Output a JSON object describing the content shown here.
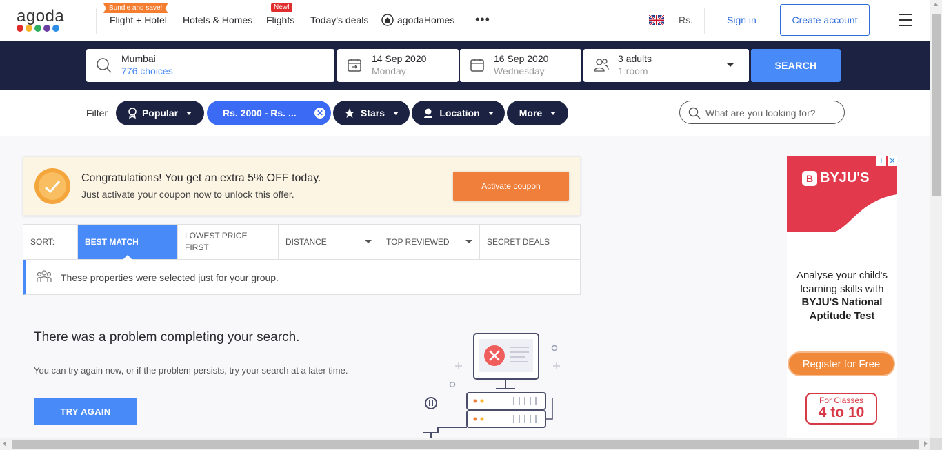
{
  "header": {
    "logo_text": "agoda",
    "logo_colors": [
      "#e12d2d",
      "#f7b32b",
      "#2fad5e",
      "#6b3fa0",
      "#2c8de5"
    ],
    "bundle_badge": "Bundle and save!",
    "nav_flight_hotel": "Flight + Hotel",
    "nav_hotels_homes": "Hotels & Homes",
    "new_badge": "New!",
    "nav_flights": "Flights",
    "nav_deals": "Today's deals",
    "nav_agoda_homes": "agodaHomes",
    "more": "•••",
    "currency": "Rs.",
    "sign_in": "Sign in",
    "create_account": "Create account"
  },
  "search": {
    "destination": "Mumbai",
    "choices": "776 choices",
    "checkin_date": "14 Sep 2020",
    "checkin_day": "Monday",
    "checkout_date": "16 Sep 2020",
    "checkout_day": "Wednesday",
    "guests": "3 adults",
    "rooms": "1 room",
    "button": "SEARCH"
  },
  "filter": {
    "label": "Filter",
    "popular": "Popular",
    "price": "Rs. 2000 - Rs. ...",
    "stars": "Stars",
    "location": "Location",
    "more": "More",
    "search_placeholder": "What are you looking for?"
  },
  "coupon": {
    "title": "Congratulations! You get an extra 5% OFF today.",
    "subtitle": "Just activate your coupon now to unlock this offer.",
    "button": "Activate coupon"
  },
  "sort": {
    "label": "SORT:",
    "best_match": "BEST MATCH",
    "lowest_price": "LOWEST PRICE FIRST",
    "distance": "DISTANCE",
    "top_reviewed": "TOP REVIEWED",
    "secret_deals": "SECRET DEALS"
  },
  "group_note": "These properties were selected just for your group.",
  "error": {
    "title": "There was a problem completing your search.",
    "subtitle": "You can try again now, or if the problem persists, try your search at a later time.",
    "button": "TRY AGAIN"
  },
  "ad": {
    "brand": "BYJU'S",
    "line1": "Analyse your child's learning skills with",
    "line2": "BYJU'S National Aptitude Test",
    "register": "Register for Free",
    "classes_label": "For Classes",
    "classes_range": "4 to 10"
  },
  "colors": {
    "accent": "#488bf8",
    "navy": "#1b2242",
    "coupon_orange": "#f07f3c"
  }
}
